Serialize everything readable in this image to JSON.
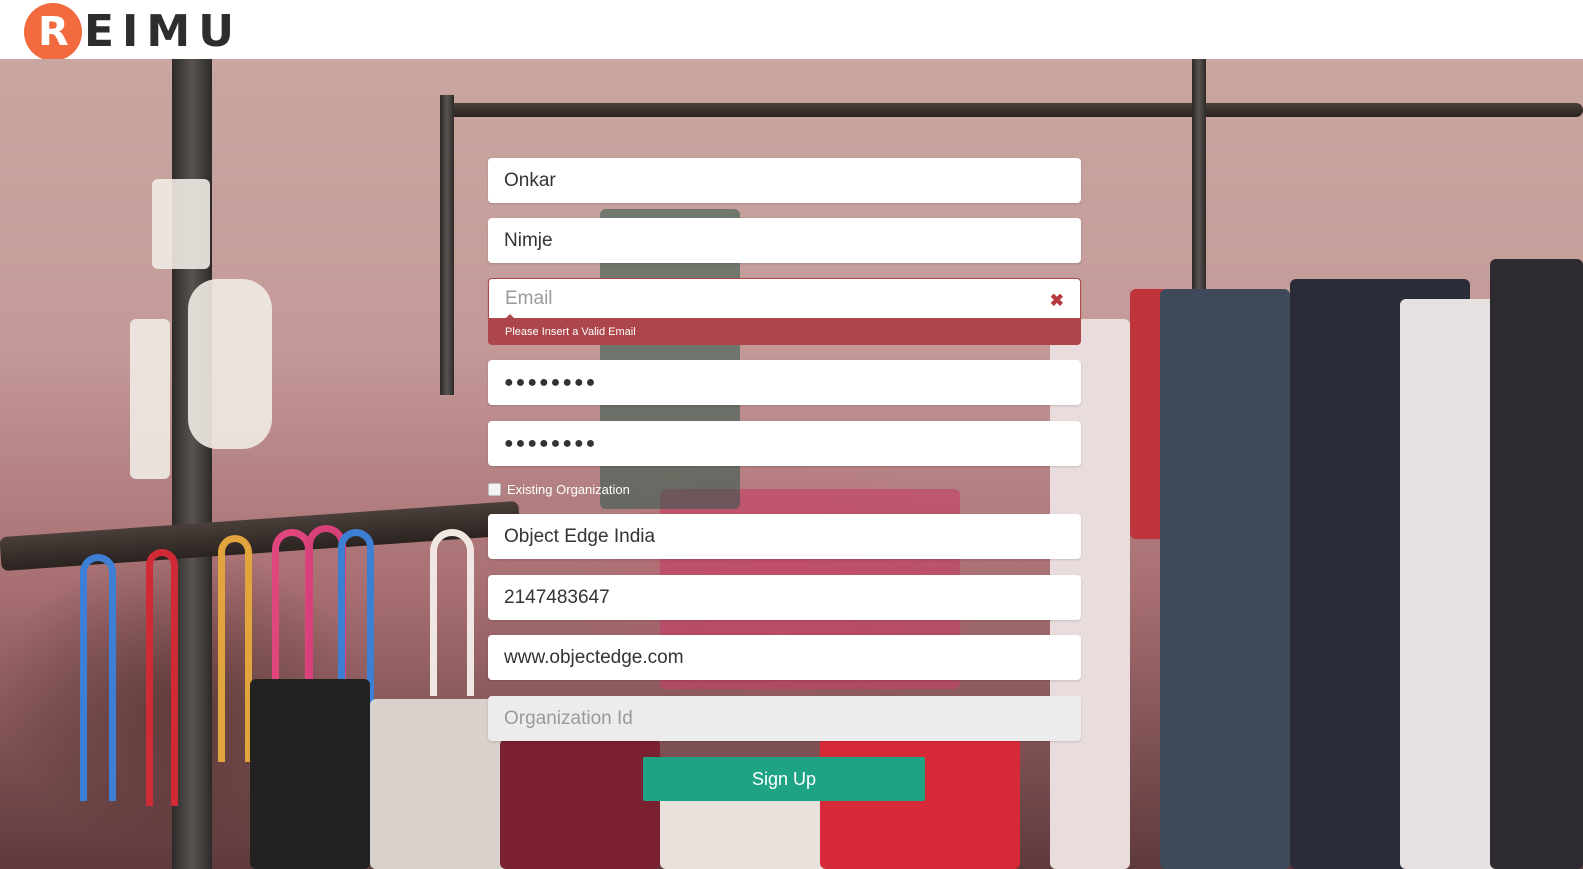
{
  "brand": {
    "logo_letter": "R",
    "logo_text": "EIMU"
  },
  "form": {
    "first_name": {
      "value": "Onkar"
    },
    "last_name": {
      "value": "Nimje"
    },
    "email": {
      "placeholder": "Email",
      "error_icon": "times-icon",
      "error_message": "Please Insert a Valid Email"
    },
    "password": {
      "masked": "●●●●●●●●"
    },
    "confirm_password": {
      "masked": "●●●●●●●●"
    },
    "existing_org": {
      "label": "Existing Organization",
      "checked": false
    },
    "organization_name": {
      "value": "Object Edge India"
    },
    "phone": {
      "value": "2147483647"
    },
    "website": {
      "value": "www.objectedge.com"
    },
    "organization_id": {
      "placeholder": "Organization Id",
      "disabled": true
    },
    "submit_label": "Sign Up"
  },
  "colors": {
    "brand_orange": "#f26a3d",
    "error_red": "#ad464a",
    "submit_green": "#1ea484"
  }
}
